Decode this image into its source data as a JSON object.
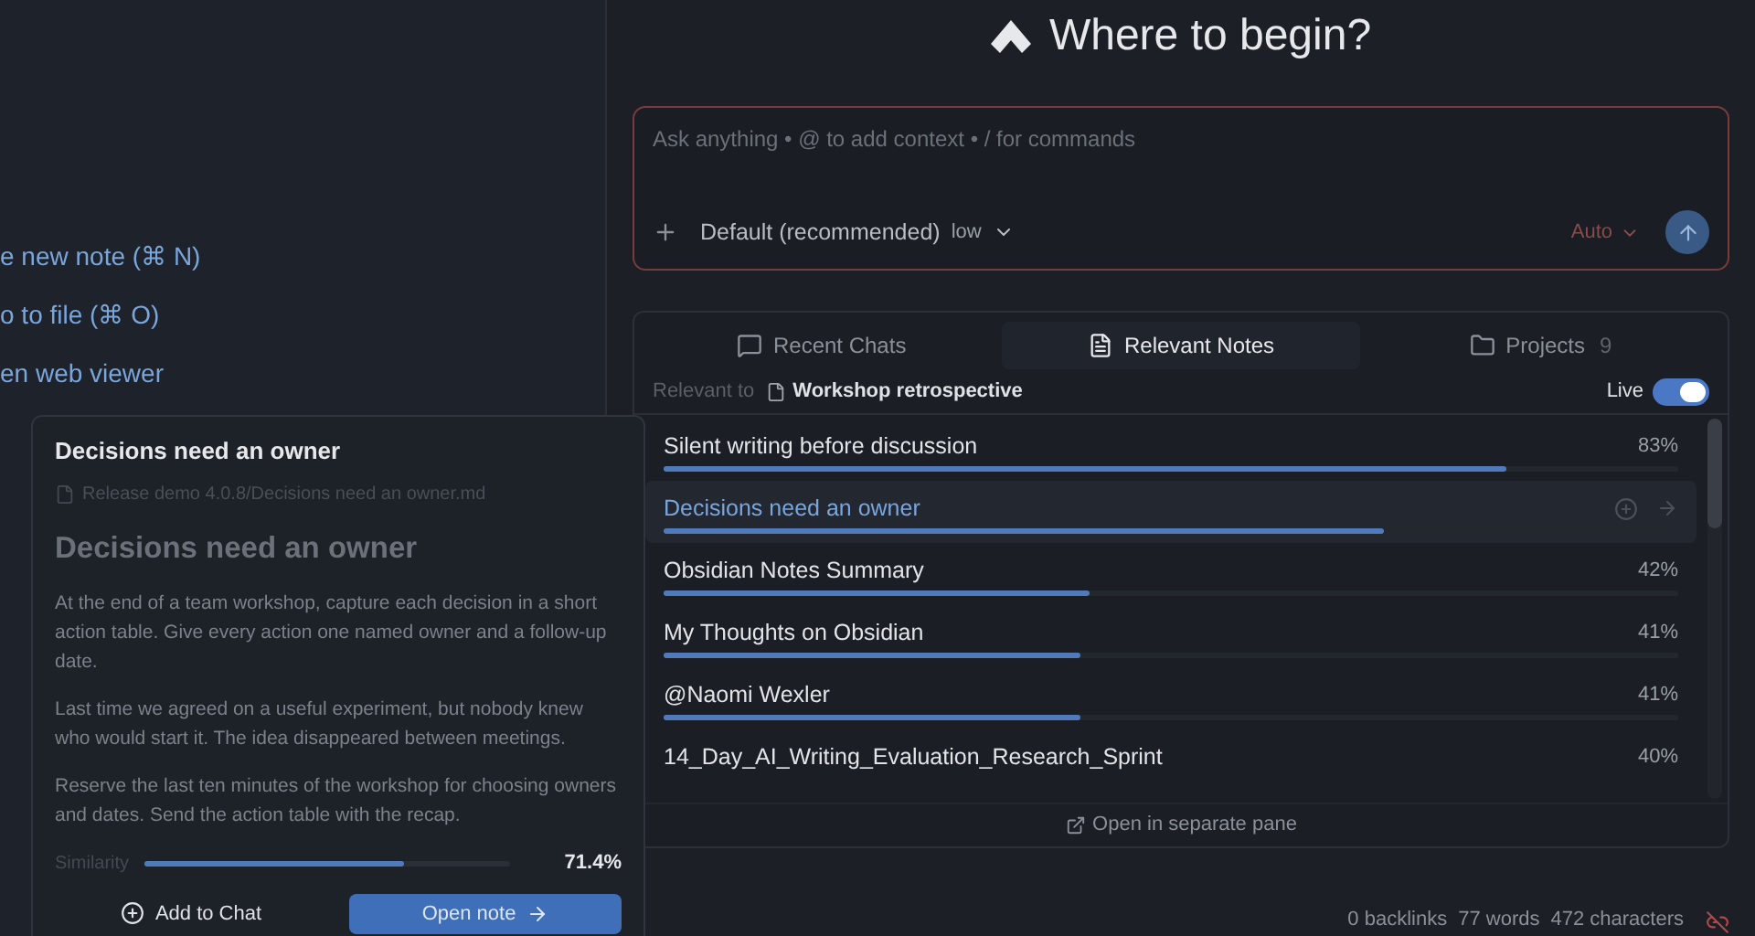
{
  "editor": {
    "commands": [
      "e new note (⌘ N)",
      "o to file (⌘ O)",
      "en web viewer"
    ]
  },
  "header": {
    "title": "Where to begin?"
  },
  "composer": {
    "placeholder": "Ask anything • @ to add context • / for commands",
    "model": "Default (recommended)",
    "effort": "low",
    "mode": "Auto"
  },
  "tabs": [
    {
      "kind": "chat",
      "label": "Recent Chats",
      "selected": false
    },
    {
      "kind": "note",
      "label": "Relevant Notes",
      "selected": true
    },
    {
      "kind": "folder",
      "label": "Projects",
      "count": "9",
      "selected": false
    }
  ],
  "relevant": {
    "prefix": "Relevant to",
    "note": "Workshop retrospective",
    "live_label": "Live",
    "live_on": true
  },
  "notes": [
    {
      "title": "Silent writing before discussion",
      "reading": "83%",
      "level": 0.83,
      "selected": false
    },
    {
      "title": "Decisions need an owner",
      "level": 0.71,
      "selected": true
    },
    {
      "title": "Obsidian Notes Summary",
      "reading": "42%",
      "level": 0.42,
      "selected": false
    },
    {
      "title": "My Thoughts on Obsidian",
      "reading": "41%",
      "level": 0.41,
      "selected": false
    },
    {
      "title": "@Naomi Wexler",
      "reading": "41%",
      "level": 0.41,
      "selected": false
    },
    {
      "title": "14_Day_AI_Writing_Evaluation_Research_Sprint",
      "reading": "40%",
      "selected": false
    }
  ],
  "open_pane": "Open in separate pane",
  "status_bar": [
    "0 backlinks",
    "77 words",
    "472 characters"
  ],
  "hover_card": {
    "title": "Decisions need an owner",
    "path": "Release demo 4.0.8/Decisions need an owner.md",
    "heading": "Decisions need an owner",
    "paragraphs": [
      "At the end of a team workshop, capture each decision in a short action table. Give every action one named owner and a follow-up date.",
      "Last time we agreed on a useful experiment, but nobody knew who would start it. The idea disappeared between meetings.",
      "Reserve the last ten minutes of the workshop for choosing owners and dates. Send the action table with the recap."
    ],
    "similarity_label": "Similarity",
    "similarity_reading": "71.4%",
    "level": 0.714,
    "add_button": "Add to Chat",
    "open_button": "Open note"
  }
}
